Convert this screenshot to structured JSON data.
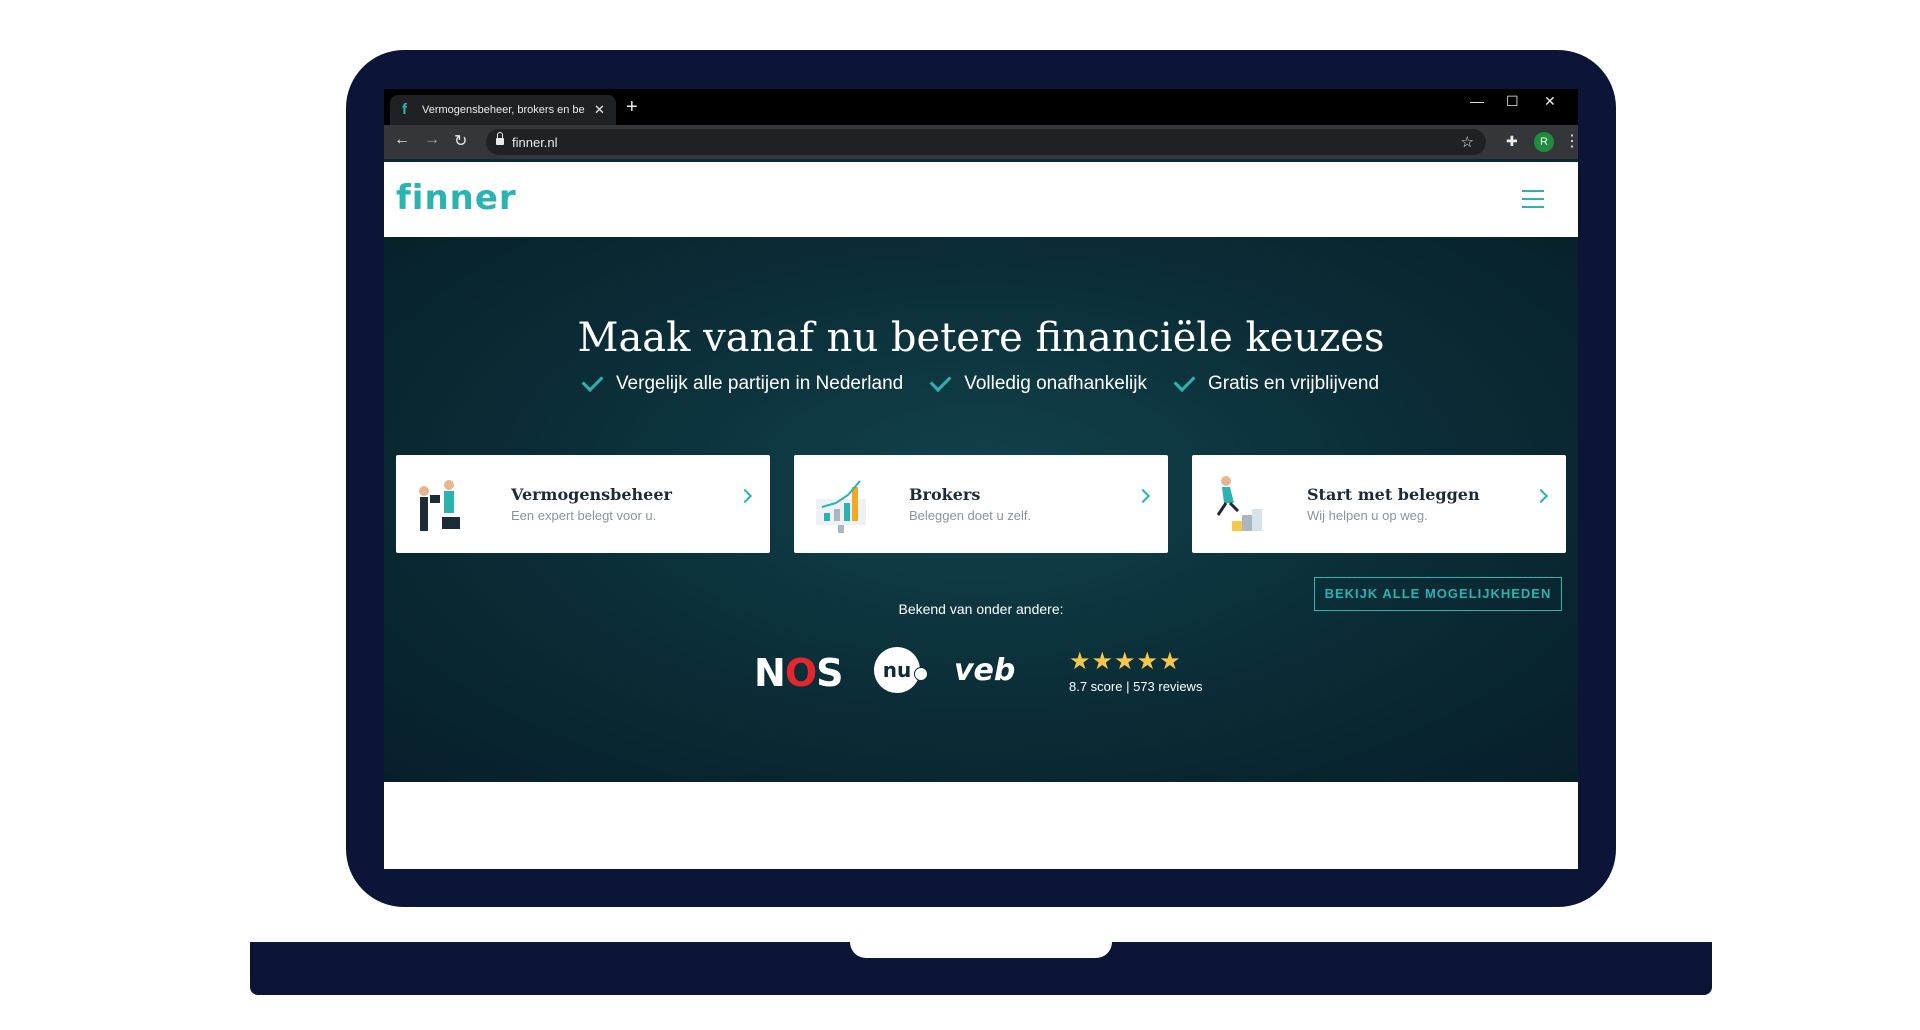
{
  "browser": {
    "tab_title": "Vermogensbeheer, brokers en be",
    "tab_close": "✕",
    "new_tab": "+",
    "url": "finner.nl",
    "profile_initial": "R",
    "window_controls": [
      "—",
      "☐",
      "✕"
    ]
  },
  "site": {
    "logo": "finner",
    "hero_title": "Maak vanaf nu betere financiële keuzes",
    "benefits": [
      "Vergelijk alle partijen in Nederland",
      "Volledig onafhankelijk",
      "Gratis en vrijblijvend"
    ],
    "cards": [
      {
        "title": "Vermogensbeheer",
        "subtitle": "Een expert belegt voor u."
      },
      {
        "title": "Brokers",
        "subtitle": "Beleggen doet u zelf."
      },
      {
        "title": "Start met beleggen",
        "subtitle": "Wij helpen u op weg."
      }
    ],
    "all_button": "BEKIJK ALLE MOGELIJKHEDEN",
    "known_from": "Bekend van onder andere:",
    "press": {
      "nos_n": "N",
      "nos_o": "O",
      "nos_s": "S",
      "nu": "nu",
      "veb": "veb"
    },
    "rating": {
      "stars": "★★★★★",
      "score_text": "8.7 score | 573 reviews"
    }
  },
  "colors": {
    "accent": "#2bb3b1",
    "hero_bg": "#0a2c36",
    "laptop": "#0c1437"
  }
}
